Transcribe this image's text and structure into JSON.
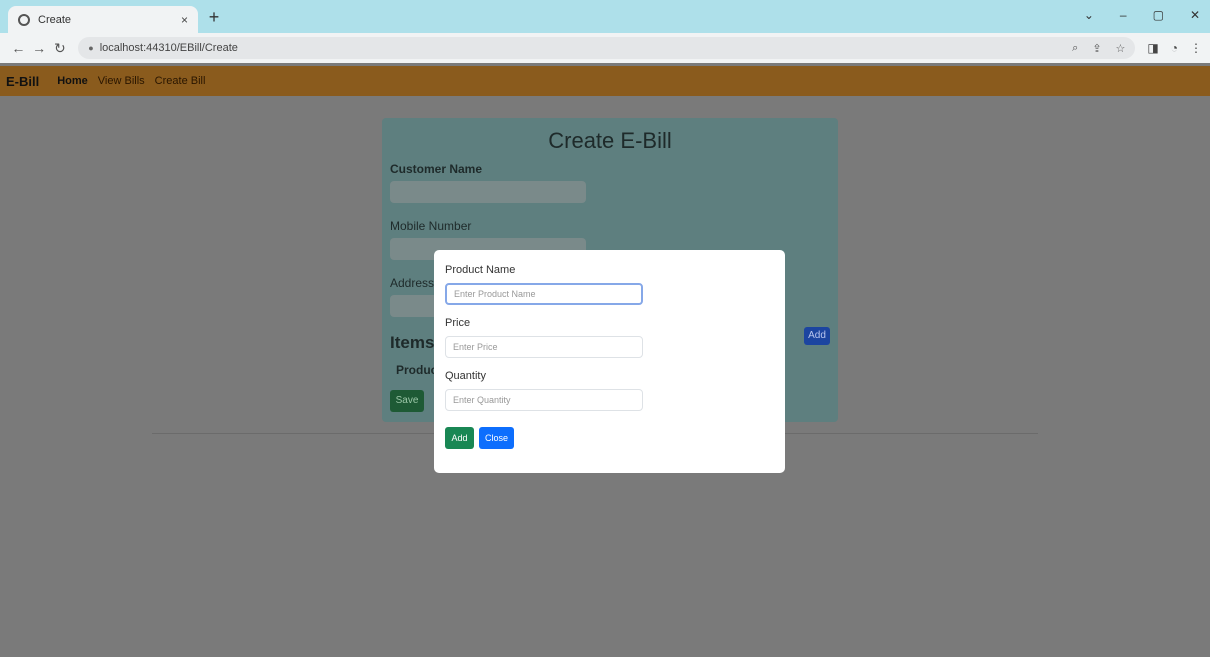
{
  "browser": {
    "tab_title": "Create",
    "tab_close": "×",
    "new_tab": "+",
    "url": "localhost:44310/EBill/Create",
    "window_controls": [
      "⌄",
      "–",
      "▢",
      "✕"
    ]
  },
  "navbar": {
    "brand": "E-Bill",
    "links": [
      "Home",
      "View Bills",
      "Create Bill"
    ]
  },
  "form": {
    "title": "Create E-Bill",
    "customer_name_label": "Customer Name",
    "mobile_number_label": "Mobile Number",
    "address_label": "Address",
    "items_heading": "Items",
    "product_column": "Product",
    "add_item_button": "Add",
    "save_button": "Save"
  },
  "modal": {
    "product_name_label": "Product Name",
    "product_name_placeholder": "Enter Product Name",
    "price_label": "Price",
    "price_placeholder": "Enter Price",
    "quantity_label": "Quantity",
    "quantity_placeholder": "Enter Quantity",
    "add_button": "Add",
    "close_button": "Close"
  },
  "colors": {
    "navbar": "#8a5b1d",
    "overlay": "#7a7a7a",
    "card": "#5e7f7f",
    "add_button": "#198754",
    "close_button": "#0d6efd"
  }
}
